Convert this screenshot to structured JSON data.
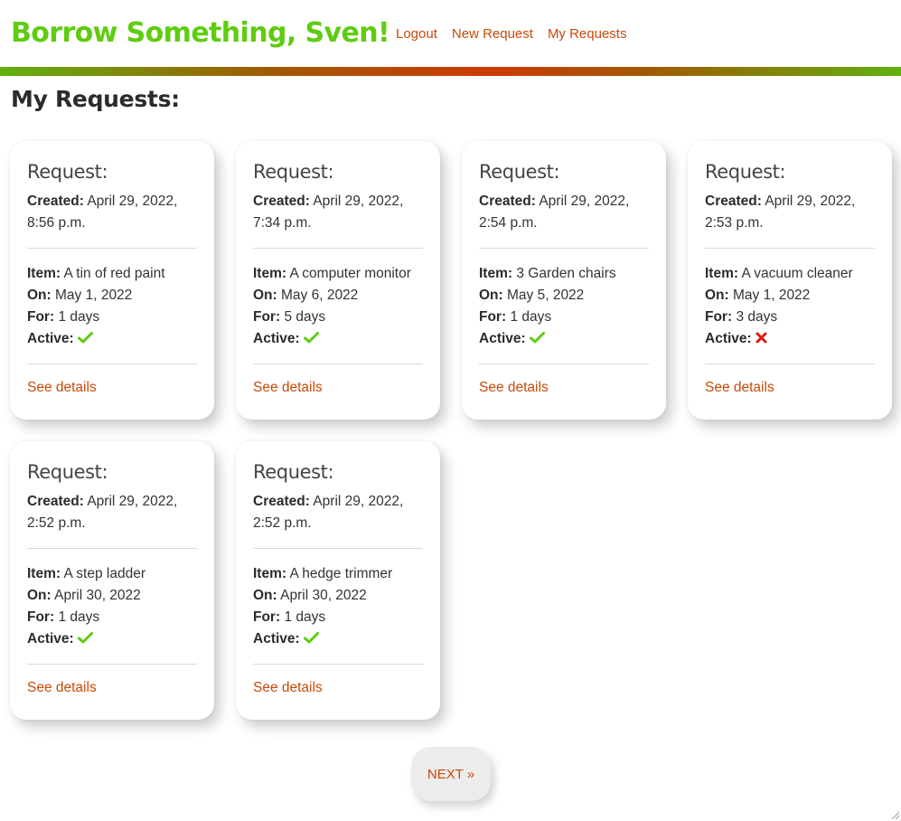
{
  "header": {
    "brand": "Borrow Something, Sven!",
    "nav": [
      {
        "label": "Logout"
      },
      {
        "label": "New Request"
      },
      {
        "label": "My Requests"
      }
    ]
  },
  "page_title": "My Requests:",
  "labels": {
    "card_title": "Request:",
    "created": "Created:",
    "item": "Item:",
    "on": "On:",
    "for": "For:",
    "active": "Active:",
    "details": "See details"
  },
  "requests": [
    {
      "created_1": "April 29, 2022,",
      "created_2": "8:56 p.m.",
      "item": "A tin of red paint",
      "on": "May 1, 2022",
      "for": "1 days",
      "active": true
    },
    {
      "created_1": "April 29, 2022,",
      "created_2": "7:34 p.m.",
      "item": "A computer monitor",
      "on": "May 6, 2022",
      "for": "5 days",
      "active": true
    },
    {
      "created_1": "April 29, 2022,",
      "created_2": "2:54 p.m.",
      "item": "3 Garden chairs",
      "on": "May 5, 2022",
      "for": "1 days",
      "active": true
    },
    {
      "created_1": "April 29, 2022,",
      "created_2": "2:53 p.m.",
      "item": "A vacuum cleaner",
      "on": "May 1, 2022",
      "for": "3 days",
      "active": false
    },
    {
      "created_1": "April 29, 2022,",
      "created_2": "2:52 p.m.",
      "item": "A step ladder",
      "on": "April 30, 2022",
      "for": "1 days",
      "active": true
    },
    {
      "created_1": "April 29, 2022,",
      "created_2": "2:52 p.m.",
      "item": "A hedge trimmer",
      "on": "April 30, 2022",
      "for": "1 days",
      "active": true
    }
  ],
  "pagination": {
    "next_label": "NEXT »"
  },
  "icons": {
    "active_true": "check-icon",
    "active_false": "cross-icon"
  },
  "colors": {
    "brand": "#5fcc10",
    "link": "#c84a09",
    "check": "#5fcc10",
    "cross": "#e01818"
  }
}
